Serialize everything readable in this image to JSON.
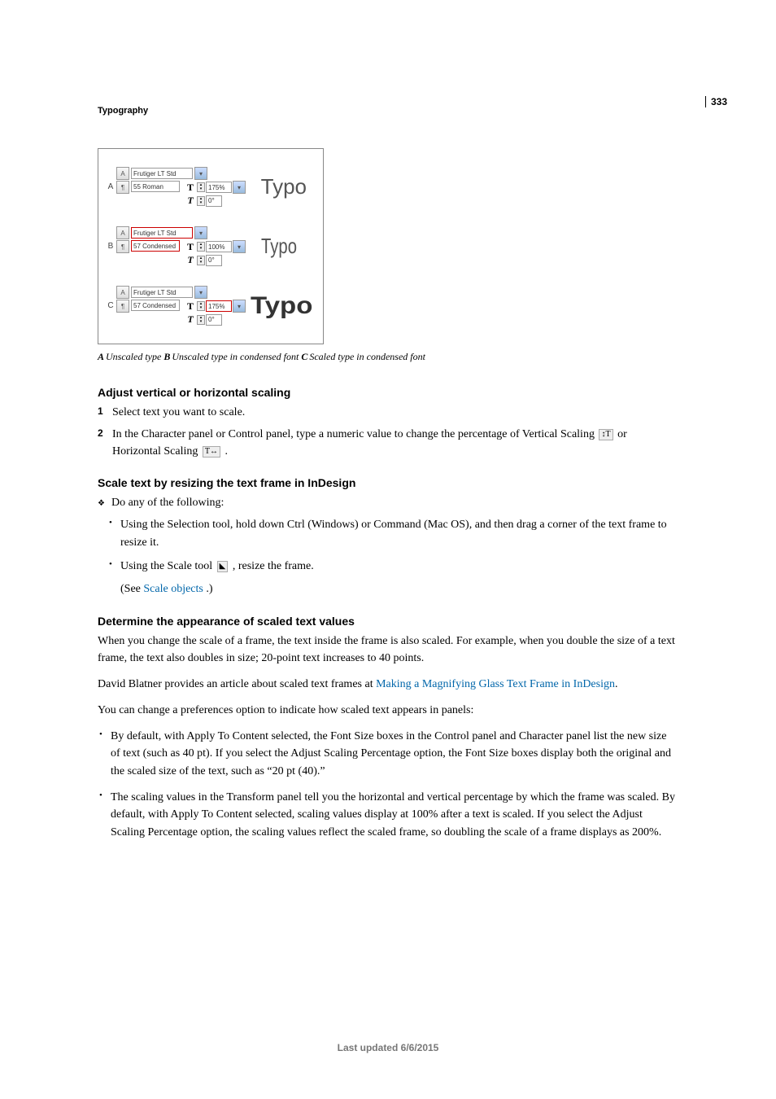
{
  "pageNumber": "333",
  "headerTitle": "Typography",
  "figure": {
    "rowA": {
      "label": "A",
      "fontFamily": "Frutiger LT Std",
      "fontStyle": "55 Roman",
      "vScale": "175%",
      "skew": "0°",
      "sample": "Typo"
    },
    "rowB": {
      "label": "B",
      "fontFamily": "Frutiger LT Std",
      "fontStyle": "57 Condensed",
      "vScale": "100%",
      "skew": "0°",
      "sample": "Typo"
    },
    "rowC": {
      "label": "C",
      "fontFamily": "Frutiger LT Std",
      "fontStyle": "57 Condensed",
      "vScale": "175%",
      "skew": "0°",
      "sample": "Typo"
    }
  },
  "caption": {
    "a_label": "A",
    "a_text": "Unscaled type  ",
    "b_label": "B",
    "b_text": "Unscaled type in condensed font  ",
    "c_label": "C",
    "c_text": "Scaled type in condensed font"
  },
  "section1": {
    "heading": "Adjust vertical or horizontal scaling",
    "step1": "Select text you want to scale.",
    "step2a": "In the Character panel or Control panel, type a numeric value to change the percentage of Vertical Scaling ",
    "step2b": "or Horizontal Scaling ",
    "step2c": "."
  },
  "section2": {
    "heading": "Scale text by resizing the text frame in InDesign",
    "intro": "Do any of the following:",
    "bullet1": "Using the Selection tool, hold down Ctrl (Windows) or Command (Mac OS), and then drag a corner of the text frame to resize it.",
    "bullet2a": "Using the Scale tool ",
    "bullet2b": " , resize the frame.",
    "seeText": "(See ",
    "seeLink": "Scale objects",
    "seeEnd": " .)"
  },
  "section3": {
    "heading": "Determine the appearance of scaled text values",
    "p1": "When you change the scale of a frame, the text inside the frame is also scaled. For example, when you double the size of a text frame, the text also doubles in size; 20-point text increases to 40 points.",
    "p2a": "David Blatner provides an article about scaled text frames at ",
    "p2link": "Making a Magnifying Glass Text Frame in InDesign",
    "p2b": ".",
    "p3": "You can change a preferences option to indicate how scaled text appears in panels:",
    "b1": "By default, with Apply To Content selected, the Font Size boxes in the Control panel and Character panel list the new size of text (such as 40 pt). If you select the Adjust Scaling Percentage option, the Font Size boxes display both the original and the scaled size of the text, such as “20 pt (40).”",
    "b2": "The scaling values in the Transform panel tell you the horizontal and vertical percentage by which the frame was scaled. By default, with Apply To Content selected, scaling values display at 100% after a text is scaled. If you select the Adjust Scaling Percentage option, the scaling values reflect the scaled frame, so doubling the scale of a frame displays as 200%."
  },
  "footer": "Last updated 6/6/2015",
  "icons": {
    "A": "A",
    "pilcrow": "¶",
    "T": "T",
    "upDown": "↕",
    "spinner": "▾",
    "scaleTool": "◣"
  }
}
